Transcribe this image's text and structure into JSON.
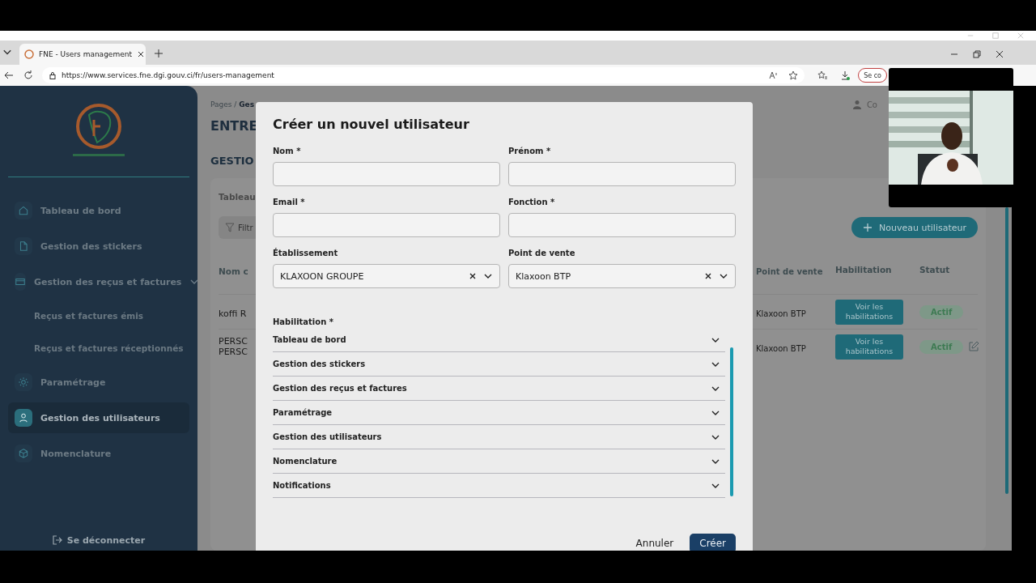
{
  "browser": {
    "tab_title": "FNE - Users management",
    "url": "https://www.services.fne.dgi.gouv.ci/fr/users-management",
    "profile_button": "Se co"
  },
  "sidebar": {
    "items": [
      {
        "label": "Tableau de bord",
        "selected": false
      },
      {
        "label": "Gestion des stickers",
        "selected": false
      },
      {
        "label": "Gestion des reçus et factures",
        "selected": false,
        "expanded": true,
        "children": [
          {
            "label": "Reçus et factures émis"
          },
          {
            "label": "Reçus et factures réceptionnés"
          }
        ]
      },
      {
        "label": "Paramétrage",
        "selected": false
      },
      {
        "label": "Gestion des utilisateurs",
        "selected": true
      },
      {
        "label": "Nomenclature",
        "selected": false
      }
    ],
    "logout": "Se déconnecter"
  },
  "page": {
    "breadcrumb": "Pages / **Ges**",
    "title": "ENTRE",
    "user_menu": "Co",
    "section_title": "GESTIO",
    "card_title": "Tableau",
    "filter_button": "Filtr",
    "new_user_button": "Nouveau utilisateur",
    "table": {
      "columns": [
        "Nom c",
        "Point de vente",
        "Habilitation",
        "Statut"
      ],
      "rows": [
        {
          "name": [
            "koffi R"
          ],
          "point_de_vente": "Klaxoon BTP",
          "habilitation": "Voir les habilitations",
          "status": "Actif",
          "editable": false
        },
        {
          "name": [
            "PERSC",
            "PERSC"
          ],
          "point_de_vente": "Klaxoon BTP",
          "habilitation": "Voir les habilitations",
          "status": "Actif",
          "editable": true
        }
      ]
    }
  },
  "modal": {
    "title": "Créer un nouvel utilisateur",
    "fields": [
      {
        "label": "Nom *",
        "kind": "text"
      },
      {
        "label": "Prénom *",
        "kind": "text"
      },
      {
        "label": "Email *",
        "kind": "text"
      },
      {
        "label": "Fonction *",
        "kind": "text"
      },
      {
        "label": "Établissement",
        "kind": "select",
        "value": "KLAXOON GROUPE"
      },
      {
        "label": "Point de vente",
        "kind": "select",
        "value": "Klaxoon BTP"
      }
    ],
    "habilitation_label": "Habilitation *",
    "sections": [
      {
        "label": "Tableau de bord",
        "expanded": false
      },
      {
        "label": "Gestion des stickers",
        "expanded": false
      },
      {
        "label": "Gestion des reçus et factures",
        "expanded": false
      },
      {
        "label": "Paramétrage",
        "expanded": false
      },
      {
        "label": "Gestion des utilisateurs",
        "expanded": false
      },
      {
        "label": "Nomenclature",
        "expanded": false
      },
      {
        "label": "Notifications",
        "expanded": false
      }
    ],
    "cancel_button": "Annuler",
    "submit_button": "Créer"
  }
}
